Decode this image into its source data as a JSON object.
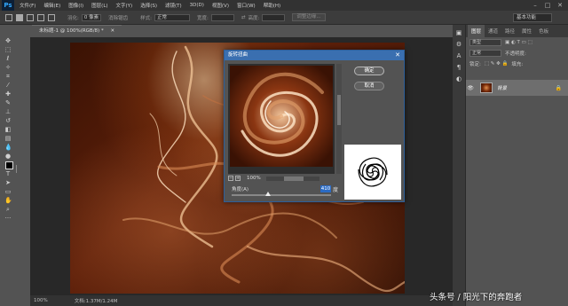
{
  "app": {
    "logo": "Ps"
  },
  "menubar": {
    "items": [
      "文件(F)",
      "编辑(E)",
      "图像(I)",
      "图层(L)",
      "文字(Y)",
      "选择(S)",
      "滤镜(T)",
      "3D(D)",
      "视图(V)",
      "窗口(W)",
      "帮助(H)"
    ]
  },
  "options": {
    "feather_label": "羽化:",
    "feather_value": "0 像素",
    "antialias_label": "消除锯齿",
    "style_label": "样式:",
    "style_value": "正常",
    "width_label": "宽度:",
    "height_label": "高度:",
    "refine_button": "调整边缘...",
    "workspace": "基本功能"
  },
  "document": {
    "tab_title": "未标题-1 @ 100%(RGB/8) *",
    "zoom": "100%",
    "doc_info": "文档:1.37M/1.24M"
  },
  "layers_panel": {
    "tabs": [
      "图层",
      "通道",
      "路径",
      "属性",
      "色板"
    ],
    "kind_label": "类型",
    "blend_mode": "正常",
    "opacity_label": "不透明度:",
    "lock_label": "锁定:",
    "fill_label": "填充:",
    "layer_name": "背景"
  },
  "dialog": {
    "title": "旋转扭曲",
    "ok_label": "确定",
    "cancel_label": "取消",
    "zoom_value": "100%",
    "angle_label": "角度(A)",
    "angle_value": "410",
    "angle_unit": "度"
  },
  "watermark": "头条号 / 阳光下的奔跑者"
}
